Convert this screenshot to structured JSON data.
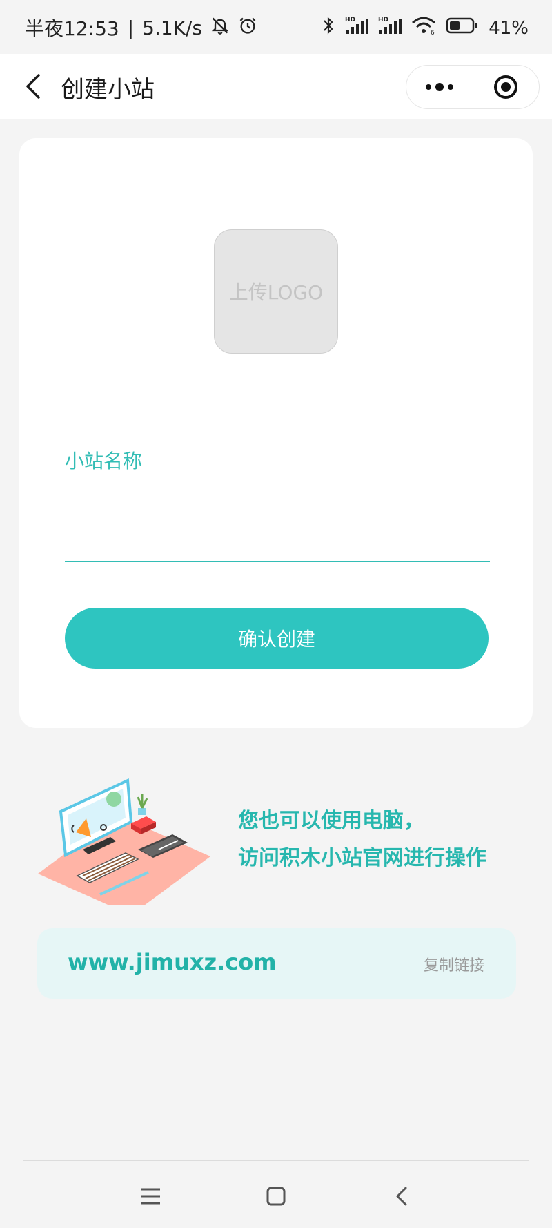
{
  "status_bar": {
    "time": "半夜12:53",
    "network_speed": "5.1K/s",
    "battery_percent": "41%",
    "signal_label_1": "HD",
    "signal_label_2": "HD",
    "wifi_label": "6",
    "icons": [
      "mute-bell-icon",
      "alarm-icon",
      "bluetooth-icon",
      "signal-icon",
      "wifi-icon",
      "battery-icon"
    ]
  },
  "navbar": {
    "title": "创建小站",
    "icons": [
      "back-arrow-icon",
      "more-dots-icon",
      "close-circle-icon"
    ]
  },
  "form": {
    "logo_upload_text": "上传LOGO",
    "name_label": "小站名称",
    "name_value": "",
    "confirm_button": "确认创建"
  },
  "promo": {
    "line1": "您也可以使用电脑，",
    "line2": "访问积木小站官网进行操作"
  },
  "url_box": {
    "url": "www.jimuxz.com",
    "copy_label": "复制链接"
  },
  "colors": {
    "accent": "#2ec5c0",
    "accent_text": "#27b7ae",
    "page_bg": "#f4f4f4",
    "url_bg": "#e6f6f6"
  },
  "system_nav": {
    "icons": [
      "menu-icon",
      "home-square-icon",
      "back-chevron-icon"
    ]
  }
}
